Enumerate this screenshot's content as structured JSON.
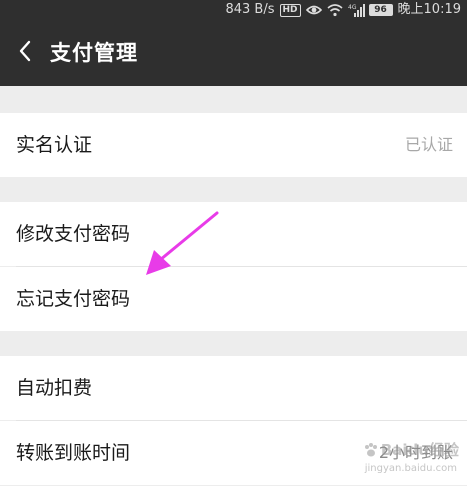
{
  "status_bar": {
    "speed": "843 B/s",
    "hd_badge": "HD",
    "eye_icon": "eye-icon",
    "wifi_icon": "wifi-icon",
    "signal_label": "4G",
    "battery": "96",
    "time": "晚上10:19"
  },
  "header": {
    "back_icon": "chevron-left-icon",
    "title": "支付管理"
  },
  "sections": [
    {
      "items": [
        {
          "label": "实名认证",
          "value": "已认证"
        }
      ]
    },
    {
      "items": [
        {
          "label": "修改支付密码"
        },
        {
          "label": "忘记支付密码"
        }
      ]
    },
    {
      "items": [
        {
          "label": "自动扣费"
        },
        {
          "label": "转账到账时间",
          "value": "2小时到账"
        }
      ]
    }
  ],
  "annotation": {
    "arrow_color": "#e83be8",
    "target": "忘记支付密码"
  },
  "watermark": {
    "brand": "Baidu经验",
    "url": "jingyan.baidu.com"
  }
}
